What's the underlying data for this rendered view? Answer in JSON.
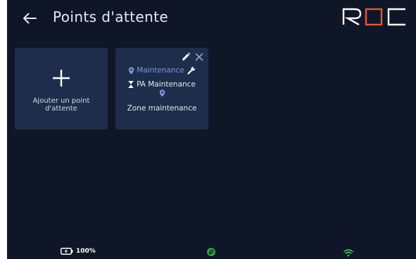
{
  "header": {
    "title": "Points d'attente",
    "back_icon": "arrow-left-icon",
    "logo_text": "ROC"
  },
  "tiles": {
    "add": {
      "label": "Ajouter un point\nd'attente",
      "icon": "plus-icon"
    },
    "waiting_point": {
      "category": "Maintenance",
      "name": "PA Maintenance",
      "zone": "Zone maintenance",
      "icons": [
        "pencil-icon",
        "close-icon",
        "location-pin-icon",
        "wrench-icon",
        "hourglass-icon"
      ]
    }
  },
  "status_bar": {
    "battery": "100%",
    "battery_icon": "battery-charging-icon",
    "status_icon": "leaf-icon",
    "wifi_icon": "wifi-icon"
  },
  "colors": {
    "background": "#0f1627",
    "tile": "#1d2d4b",
    "accent_orange": "#e8582a",
    "category_blue": "#7f95d6",
    "status_green": "#25a244",
    "wifi_green": "#3ddc63"
  }
}
